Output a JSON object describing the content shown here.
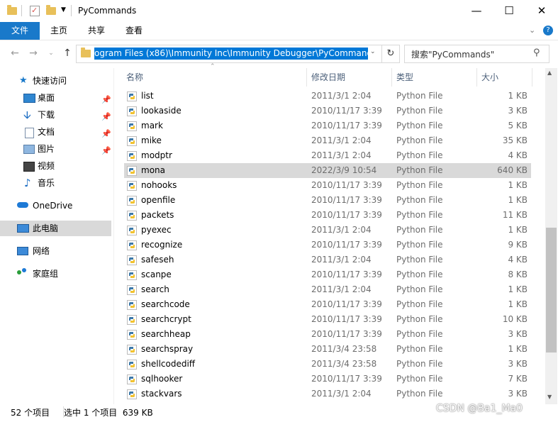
{
  "window": {
    "title": "PyCommands"
  },
  "ribbon": {
    "tabs": [
      "文件",
      "主页",
      "共享",
      "查看"
    ]
  },
  "address": {
    "path": "ogram Files (x86)\\Immunity Inc\\Immunity Debugger\\PyCommands"
  },
  "search": {
    "placeholder": "搜索\"PyCommands\""
  },
  "nav": {
    "quick_access": "快速访问",
    "items": [
      {
        "label": "桌面",
        "icon": "desktop-icon",
        "pinned": true
      },
      {
        "label": "下载",
        "icon": "download-icon",
        "pinned": true
      },
      {
        "label": "文档",
        "icon": "document-icon",
        "pinned": true
      },
      {
        "label": "图片",
        "icon": "picture-icon",
        "pinned": true
      },
      {
        "label": "视频",
        "icon": "video-icon",
        "pinned": false
      },
      {
        "label": "音乐",
        "icon": "music-icon",
        "pinned": false
      }
    ],
    "onedrive": "OneDrive",
    "this_pc": "此电脑",
    "network": "网络",
    "homegroup": "家庭组"
  },
  "columns": {
    "name": "名称",
    "date": "修改日期",
    "type": "类型",
    "size": "大小"
  },
  "files": [
    {
      "name": "list",
      "date": "2011/3/1 2:04",
      "type": "Python File",
      "size": "1 KB"
    },
    {
      "name": "lookaside",
      "date": "2010/11/17 3:39",
      "type": "Python File",
      "size": "3 KB"
    },
    {
      "name": "mark",
      "date": "2010/11/17 3:39",
      "type": "Python File",
      "size": "5 KB"
    },
    {
      "name": "mike",
      "date": "2011/3/1 2:04",
      "type": "Python File",
      "size": "35 KB"
    },
    {
      "name": "modptr",
      "date": "2011/3/1 2:04",
      "type": "Python File",
      "size": "4 KB"
    },
    {
      "name": "mona",
      "date": "2022/3/9 10:54",
      "type": "Python File",
      "size": "640 KB",
      "selected": true
    },
    {
      "name": "nohooks",
      "date": "2010/11/17 3:39",
      "type": "Python File",
      "size": "1 KB"
    },
    {
      "name": "openfile",
      "date": "2010/11/17 3:39",
      "type": "Python File",
      "size": "1 KB"
    },
    {
      "name": "packets",
      "date": "2010/11/17 3:39",
      "type": "Python File",
      "size": "11 KB"
    },
    {
      "name": "pyexec",
      "date": "2011/3/1 2:04",
      "type": "Python File",
      "size": "1 KB"
    },
    {
      "name": "recognize",
      "date": "2010/11/17 3:39",
      "type": "Python File",
      "size": "9 KB"
    },
    {
      "name": "safeseh",
      "date": "2011/3/1 2:04",
      "type": "Python File",
      "size": "4 KB"
    },
    {
      "name": "scanpe",
      "date": "2010/11/17 3:39",
      "type": "Python File",
      "size": "8 KB"
    },
    {
      "name": "search",
      "date": "2011/3/1 2:04",
      "type": "Python File",
      "size": "1 KB"
    },
    {
      "name": "searchcode",
      "date": "2010/11/17 3:39",
      "type": "Python File",
      "size": "1 KB"
    },
    {
      "name": "searchcrypt",
      "date": "2010/11/17 3:39",
      "type": "Python File",
      "size": "10 KB"
    },
    {
      "name": "searchheap",
      "date": "2010/11/17 3:39",
      "type": "Python File",
      "size": "3 KB"
    },
    {
      "name": "searchspray",
      "date": "2011/3/4 23:58",
      "type": "Python File",
      "size": "1 KB"
    },
    {
      "name": "shellcodediff",
      "date": "2011/3/4 23:58",
      "type": "Python File",
      "size": "3 KB"
    },
    {
      "name": "sqlhooker",
      "date": "2010/11/17 3:39",
      "type": "Python File",
      "size": "7 KB"
    },
    {
      "name": "stackvars",
      "date": "2011/3/1 2:04",
      "type": "Python File",
      "size": "3 KB"
    }
  ],
  "status": {
    "item_count": "52 个项目",
    "selection": "选中 1 个项目  639 KB"
  },
  "watermark": "CSDN @Ba1_Ma0",
  "colors": {
    "accent": "#1979ca",
    "selection": "#0078d7",
    "row_selected": "#d9d9d9"
  }
}
